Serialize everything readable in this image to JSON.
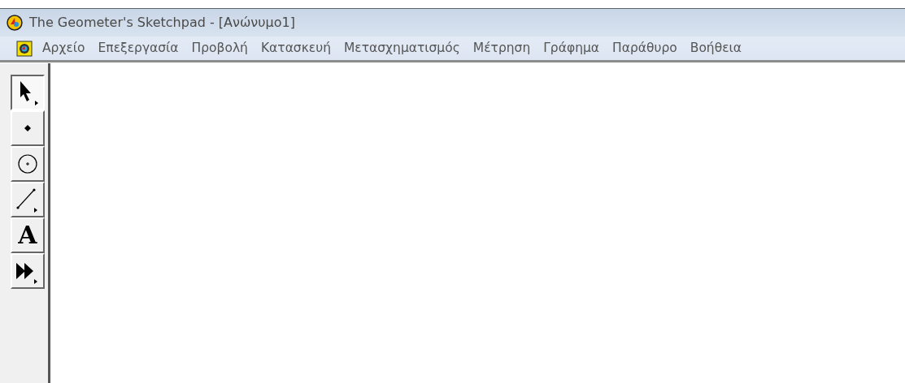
{
  "window": {
    "title": "The Geometer's Sketchpad - [Ανώνυμο1]"
  },
  "menu": {
    "items": [
      "Αρχείο",
      "Επεξεργασία",
      "Προβολή",
      "Κατασκευή",
      "Μετασχηματισμός",
      "Μέτρηση",
      "Γράφημα",
      "Παράθυρο",
      "Βοήθεια"
    ]
  },
  "toolbox": {
    "tools": [
      {
        "kind": "arrow",
        "selected": true
      },
      {
        "kind": "point",
        "selected": false
      },
      {
        "kind": "compass",
        "selected": false
      },
      {
        "kind": "line",
        "selected": false
      },
      {
        "kind": "text",
        "selected": false,
        "label": "A"
      },
      {
        "kind": "custom",
        "selected": false
      }
    ]
  }
}
